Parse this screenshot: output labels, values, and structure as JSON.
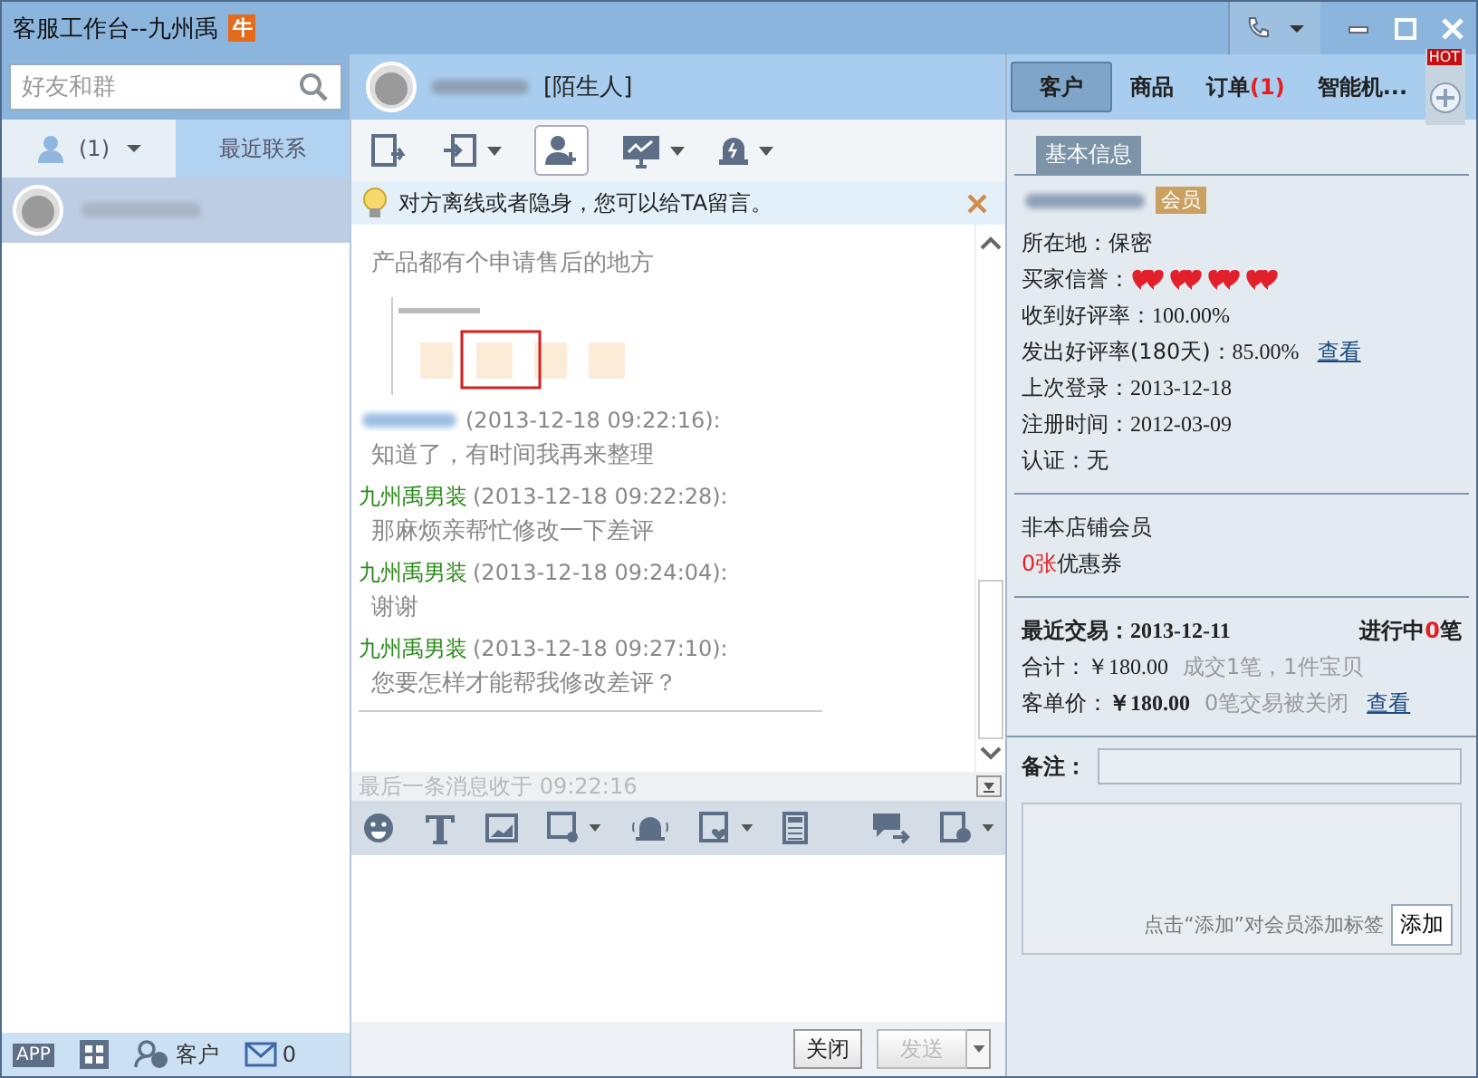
{
  "window": {
    "title": "客服工作台--九州禹",
    "badge": "牛"
  },
  "sidebar": {
    "search": {
      "placeholder": "好友和群"
    },
    "tabs": [
      {
        "label": "(1)",
        "kind": "contacts",
        "selected": false
      },
      {
        "label": "最近联系",
        "kind": "recent",
        "selected": true
      }
    ],
    "contacts": [
      {
        "selected": true
      }
    ],
    "footer": {
      "app": "APP",
      "customers": "客户",
      "mail_count": "0"
    }
  },
  "chat": {
    "contact_tag": "[陌生人]",
    "notice": "对方离线或者隐身，您可以给TA留言。",
    "messages": [
      {
        "kind": "none",
        "text": "产品都有个申请售后的地方"
      },
      {
        "kind": "customer",
        "time": "(2013-12-18 09:22:16):",
        "text": "知道了，有时间我再来整理"
      },
      {
        "kind": "self",
        "sender": "九州禹男装",
        "time": "(2013-12-18 09:22:28):",
        "text": "那麻烦亲帮忙修改一下差评"
      },
      {
        "kind": "self",
        "sender": "九州禹男装",
        "time": "(2013-12-18 09:24:04):",
        "text": "谢谢"
      },
      {
        "kind": "self",
        "sender": "九州禹男装",
        "time": "(2013-12-18 09:27:10):",
        "text": "您要怎样才能帮我修改差评？"
      }
    ],
    "last_received": "最后一条消息收于 09:22:16",
    "buttons": [
      {
        "label": "关闭",
        "disabled": false
      },
      {
        "label": "发送",
        "disabled": true
      }
    ]
  },
  "customer_panel": {
    "tabs": [
      {
        "label": "客户",
        "selected": true
      },
      {
        "label": "商品",
        "selected": false
      },
      {
        "label": "订单",
        "selected": false,
        "count": "(1)"
      },
      {
        "label": "智能机...",
        "selected": false
      }
    ],
    "hot": "HOT",
    "section_tab": "基本信息",
    "member_badge": "会员",
    "fields": [
      {
        "label": "所在地：",
        "value": "保密"
      },
      {
        "label": "买家信誉：",
        "kind": "hearts",
        "stars": 4
      },
      {
        "label": "收到好评率：",
        "value": "100.00%"
      },
      {
        "label": "发出好评率(180天)：",
        "value": "85.00%",
        "link": "查看"
      },
      {
        "label": "上次登录：",
        "value": "2013-12-18"
      },
      {
        "label": "注册时间：",
        "value": "2012-03-09"
      },
      {
        "label": "认证：",
        "value": "无"
      }
    ],
    "membership": "非本店铺会员",
    "coupon": {
      "count": "0张",
      "label": "优惠券"
    },
    "recent_trade": {
      "label": "最近交易：",
      "date": "2013-12-11",
      "ongoing_label": "进行中",
      "ongoing_count": "0",
      "ongoing_unit": "笔"
    },
    "total": {
      "label": "合计：",
      "value": "￥180.00",
      "note": "成交1笔，1件宝贝"
    },
    "unit_price": {
      "label": "客单价：",
      "value": "￥180.00",
      "note": "0笔交易被关闭",
      "link": "查看"
    },
    "remark": {
      "label": "备注："
    },
    "tag_hint": "点击“添加”对会员添加标签",
    "tag_button": "添加"
  }
}
